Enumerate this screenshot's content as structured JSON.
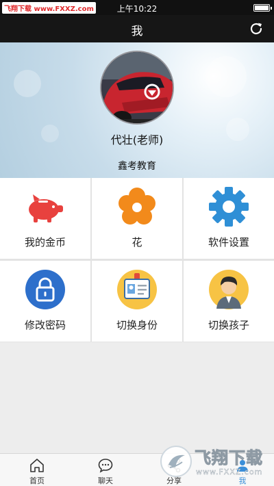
{
  "status_bar": {
    "watermark": "飞翔下载 www.FXXZ.com",
    "time": "上午10:22"
  },
  "header": {
    "title": "我",
    "refresh_icon": "refresh-icon"
  },
  "profile": {
    "name": "代壮(老师)",
    "organization": "鑫考教育"
  },
  "menu": [
    {
      "label": "我的金币",
      "icon": "piggy-bank-icon"
    },
    {
      "label": "花",
      "icon": "flower-icon"
    },
    {
      "label": "软件设置",
      "icon": "gear-icon"
    },
    {
      "label": "修改密码",
      "icon": "lock-icon"
    },
    {
      "label": "切换身份",
      "icon": "id-card-icon"
    },
    {
      "label": "切换孩子",
      "icon": "child-avatar-icon"
    }
  ],
  "tabs": [
    {
      "label": "首页",
      "icon": "home-icon"
    },
    {
      "label": "聊天",
      "icon": "chat-icon"
    },
    {
      "label": "分享",
      "icon": "share-icon"
    },
    {
      "label": "我",
      "icon": "profile-icon"
    }
  ],
  "active_tab": "我",
  "watermark_overlay": {
    "brand": "飞翔下载",
    "url": "www.FXXZ.com"
  },
  "colors": {
    "accent": "#3b8fd9",
    "header_bg": "#161616",
    "piggy": "#e8413e",
    "flower": "#f28a1b",
    "gear": "#2f8fd6",
    "lock": "#2d6fcb"
  }
}
